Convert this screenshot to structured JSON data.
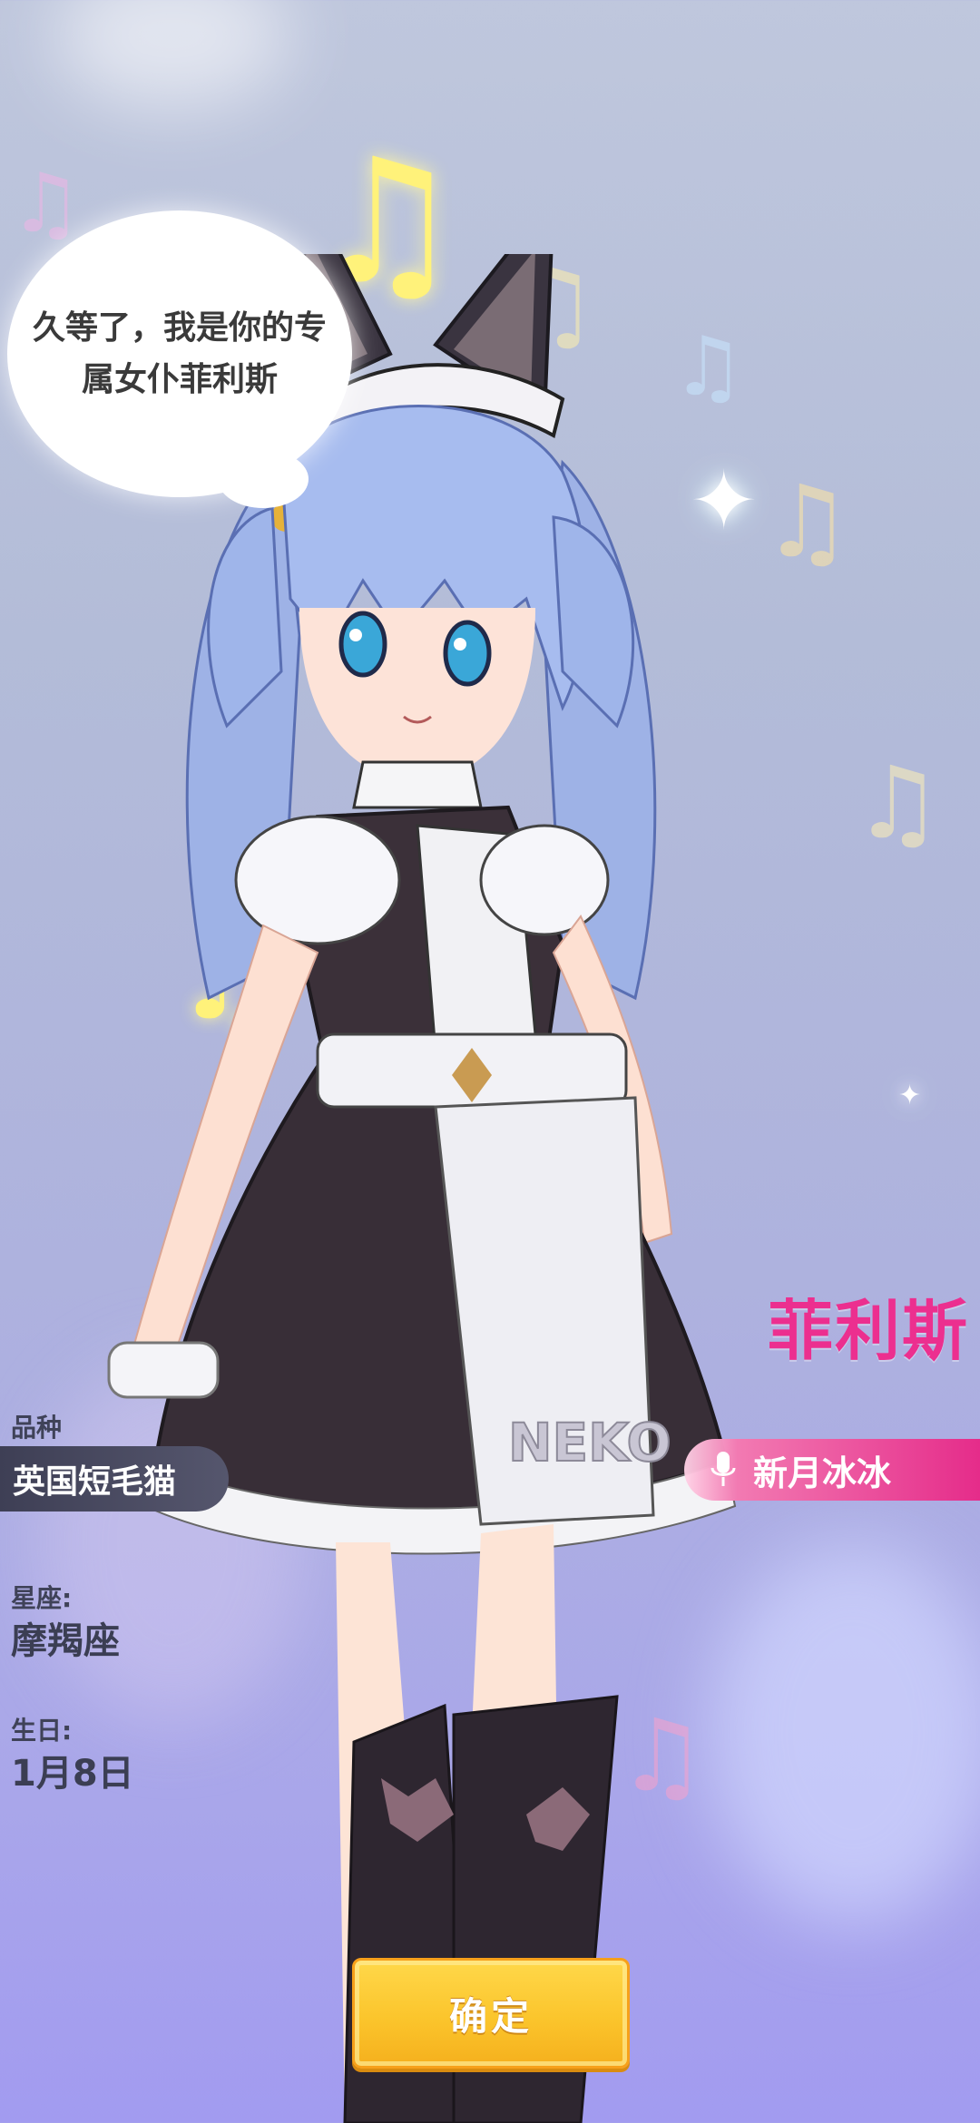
{
  "dialogue": "久等了，我是你的专属女仆菲利斯",
  "character": {
    "name": "菲利斯",
    "voice_actor": "新月冰冰",
    "apron_text": "NEKO"
  },
  "profile": {
    "breed_label": "品种",
    "breed_value": "英国短毛猫",
    "zodiac_label": "星座:",
    "zodiac_value": "摩羯座",
    "birthday_label": "生日:",
    "birthday_value": "1月8日"
  },
  "actions": {
    "confirm_label": "确定"
  },
  "colors": {
    "accent_pink": "#e52c8a",
    "button_yellow": "#fbc52c",
    "note_yellow": "#fff27a"
  },
  "icons": {
    "mic": "mic-icon",
    "note": "music-note-icon",
    "sparkle": "sparkle-icon"
  }
}
